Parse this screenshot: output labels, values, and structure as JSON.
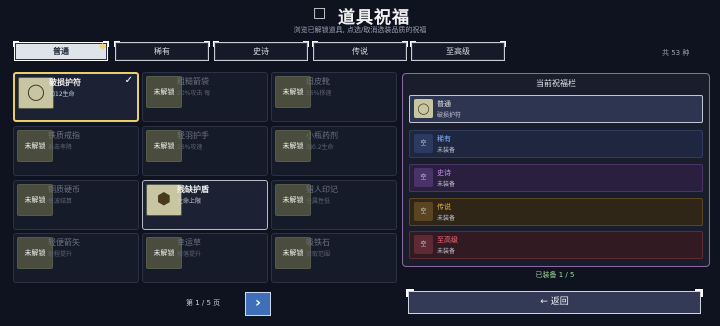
{
  "header": {
    "title": "道具祝福",
    "title_icon": "gift-icon",
    "subtitle": "浏览已解锁道具, 点选/取消选装品质的祝福"
  },
  "tabs": [
    {
      "label": "普通",
      "active": true
    },
    {
      "label": "稀有",
      "active": false
    },
    {
      "label": "史诗",
      "active": false
    },
    {
      "label": "传说",
      "active": false
    },
    {
      "label": "至高级",
      "active": false
    }
  ],
  "count_label": "共 53 种",
  "items": [
    {
      "name": "破损护符",
      "desc": "加12生命",
      "thumb": "",
      "icon": "amulet-icon",
      "state": "selected"
    },
    {
      "name": "粗糙箭袋",
      "desc": "20%攻击 每",
      "thumb": "未解锁",
      "icon": "lock-icon",
      "state": "locked"
    },
    {
      "name": "旧皮靴",
      "desc": "36%移速",
      "thumb": "未解锁",
      "icon": "lock-icon",
      "state": "locked"
    },
    {
      "name": "铁质戒指",
      "desc": "暴击率降",
      "thumb": "未解锁",
      "icon": "lock-icon",
      "state": "locked"
    },
    {
      "name": "轻羽护手",
      "desc": "26%攻速",
      "thumb": "未解锁",
      "icon": "lock-icon",
      "state": "locked"
    },
    {
      "name": "小瓶药剂",
      "desc": "加0.2生命",
      "thumb": "未解锁",
      "icon": "lock-icon",
      "state": "locked"
    },
    {
      "name": "铜质硬币",
      "desc": "每波结算",
      "thumb": "未解锁",
      "icon": "lock-icon",
      "state": "locked"
    },
    {
      "name": "残缺护盾",
      "desc": "生命上限",
      "thumb": "",
      "icon": "shield-icon",
      "state": "unlocked"
    },
    {
      "name": "猎人印记",
      "desc": "全属性低",
      "thumb": "未解锁",
      "icon": "lock-icon",
      "state": "locked"
    },
    {
      "name": "轻便箭矢",
      "desc": "射程提升",
      "thumb": "未解锁",
      "icon": "lock-icon",
      "state": "locked"
    },
    {
      "name": "幸运草",
      "desc": "掉落提升",
      "thumb": "未解锁",
      "icon": "lock-icon",
      "state": "locked"
    },
    {
      "name": "吸铁石",
      "desc": "拾取范围",
      "thumb": "未解锁",
      "icon": "lock-icon",
      "state": "locked"
    }
  ],
  "pager": {
    "label": "第 1 / 5 页",
    "next_label": "›"
  },
  "panel": {
    "title": "当前祝福栏",
    "slots": [
      {
        "tier": "普通",
        "value": "破损护符",
        "icon_text": "",
        "color": "#e6e6e6",
        "bg": "#2e3550",
        "border": "#c0c6d4",
        "icon_bg": "#c8c6a2"
      },
      {
        "tier": "稀有",
        "value": "未装备",
        "icon_text": "空",
        "color": "#7fb4ff",
        "bg": "#1e2640",
        "border": "#2f3b5e",
        "icon_bg": "#2c3a62"
      },
      {
        "tier": "史诗",
        "value": "未装备",
        "icon_text": "空",
        "color": "#d28cff",
        "bg": "#2a1f3e",
        "border": "#4a3466",
        "icon_bg": "#4a3368"
      },
      {
        "tier": "传说",
        "value": "未装备",
        "icon_text": "空",
        "color": "#f0b040",
        "bg": "#2f2618",
        "border": "#5a4422",
        "icon_bg": "#5a4422"
      },
      {
        "tier": "至高级",
        "value": "未装备",
        "icon_text": "空",
        "color": "#ff6b78",
        "bg": "#321a22",
        "border": "#5e2a36",
        "icon_bg": "#5e2a36"
      }
    ],
    "equipped": "已装备 1 / 5"
  },
  "back_button": "← 返回"
}
